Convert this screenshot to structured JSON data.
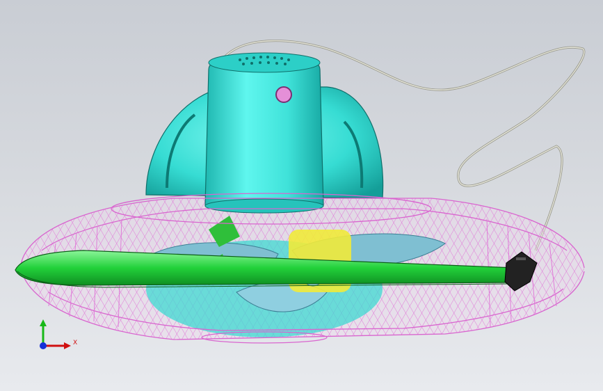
{
  "viewport": {
    "background_top": "#c9cdd4",
    "background_bottom": "#e8eaee"
  },
  "model": {
    "description_icon": "fan-assembly",
    "colors": {
      "motor": "#35e0d6",
      "guard_wire": "#e07ad8",
      "ring": "#22d13a",
      "cord": "#c8c8b8",
      "plug": "#222222",
      "button": "#e58fd8",
      "blade": "#7fbfd2",
      "hub_yellow": "#f1ea3a"
    }
  },
  "triad": {
    "x_label": "X",
    "x_color": "#d01010",
    "y_color": "#18b818",
    "z_color": "#1530d8"
  }
}
